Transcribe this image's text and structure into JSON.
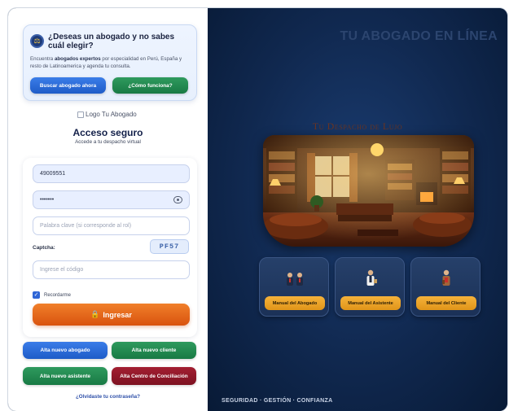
{
  "promo": {
    "title": "¿Deseas un abogado y no sabes cuál elegir?",
    "desc_prefix": "Encuentra ",
    "desc_bold": "abogados expertos",
    "desc_suffix": " por especialidad en Perú, España y resto de Latinoamerica y agenda tu consulta.",
    "search_button": "Buscar abogado ahora",
    "how_button": "¿Cómo funciona?"
  },
  "logo_alt": "Logo Tu Abogado",
  "login": {
    "title": "Acceso seguro",
    "subtitle": "Accede a tu despacho virtual",
    "user_value": "49009551",
    "password_value": "•••••••",
    "keyword_placeholder": "Palabra clave (si corresponde al rol)",
    "captcha_label": "Captcha:",
    "captcha_code": "PF57",
    "captcha_placeholder": "Ingrese el código",
    "remember_label": "Recordarme",
    "submit_label": "Ingresar"
  },
  "register": {
    "new_lawyer": "Alta nuevo abogado",
    "new_client": "Alta nuevo cliente",
    "new_assistant": "Alta nuevo asistente",
    "new_center": "Alta Centro de Conciliación"
  },
  "forgot_password": "¿Olvidaste tu contraseña?",
  "right": {
    "brand": "TU ABOGADO EN LÍNEA",
    "tagline": "Tu Despacho de Lujo",
    "manuals": [
      {
        "label": "Manual del Abogado",
        "icon": "lawyers-icon"
      },
      {
        "label": "Manual del Asistente",
        "icon": "assistant-icon"
      },
      {
        "label": "Manual del Cliente",
        "icon": "client-icon"
      }
    ],
    "footer": "SEGURIDAD · GESTIÓN · CONFIANZA"
  },
  "colors": {
    "accent_orange": "#e86a1c",
    "primary_blue": "#1e5cc8",
    "success_green": "#187a44",
    "danger_red": "#7d1221",
    "gold": "#f0a62a",
    "navy": "#10284f"
  }
}
